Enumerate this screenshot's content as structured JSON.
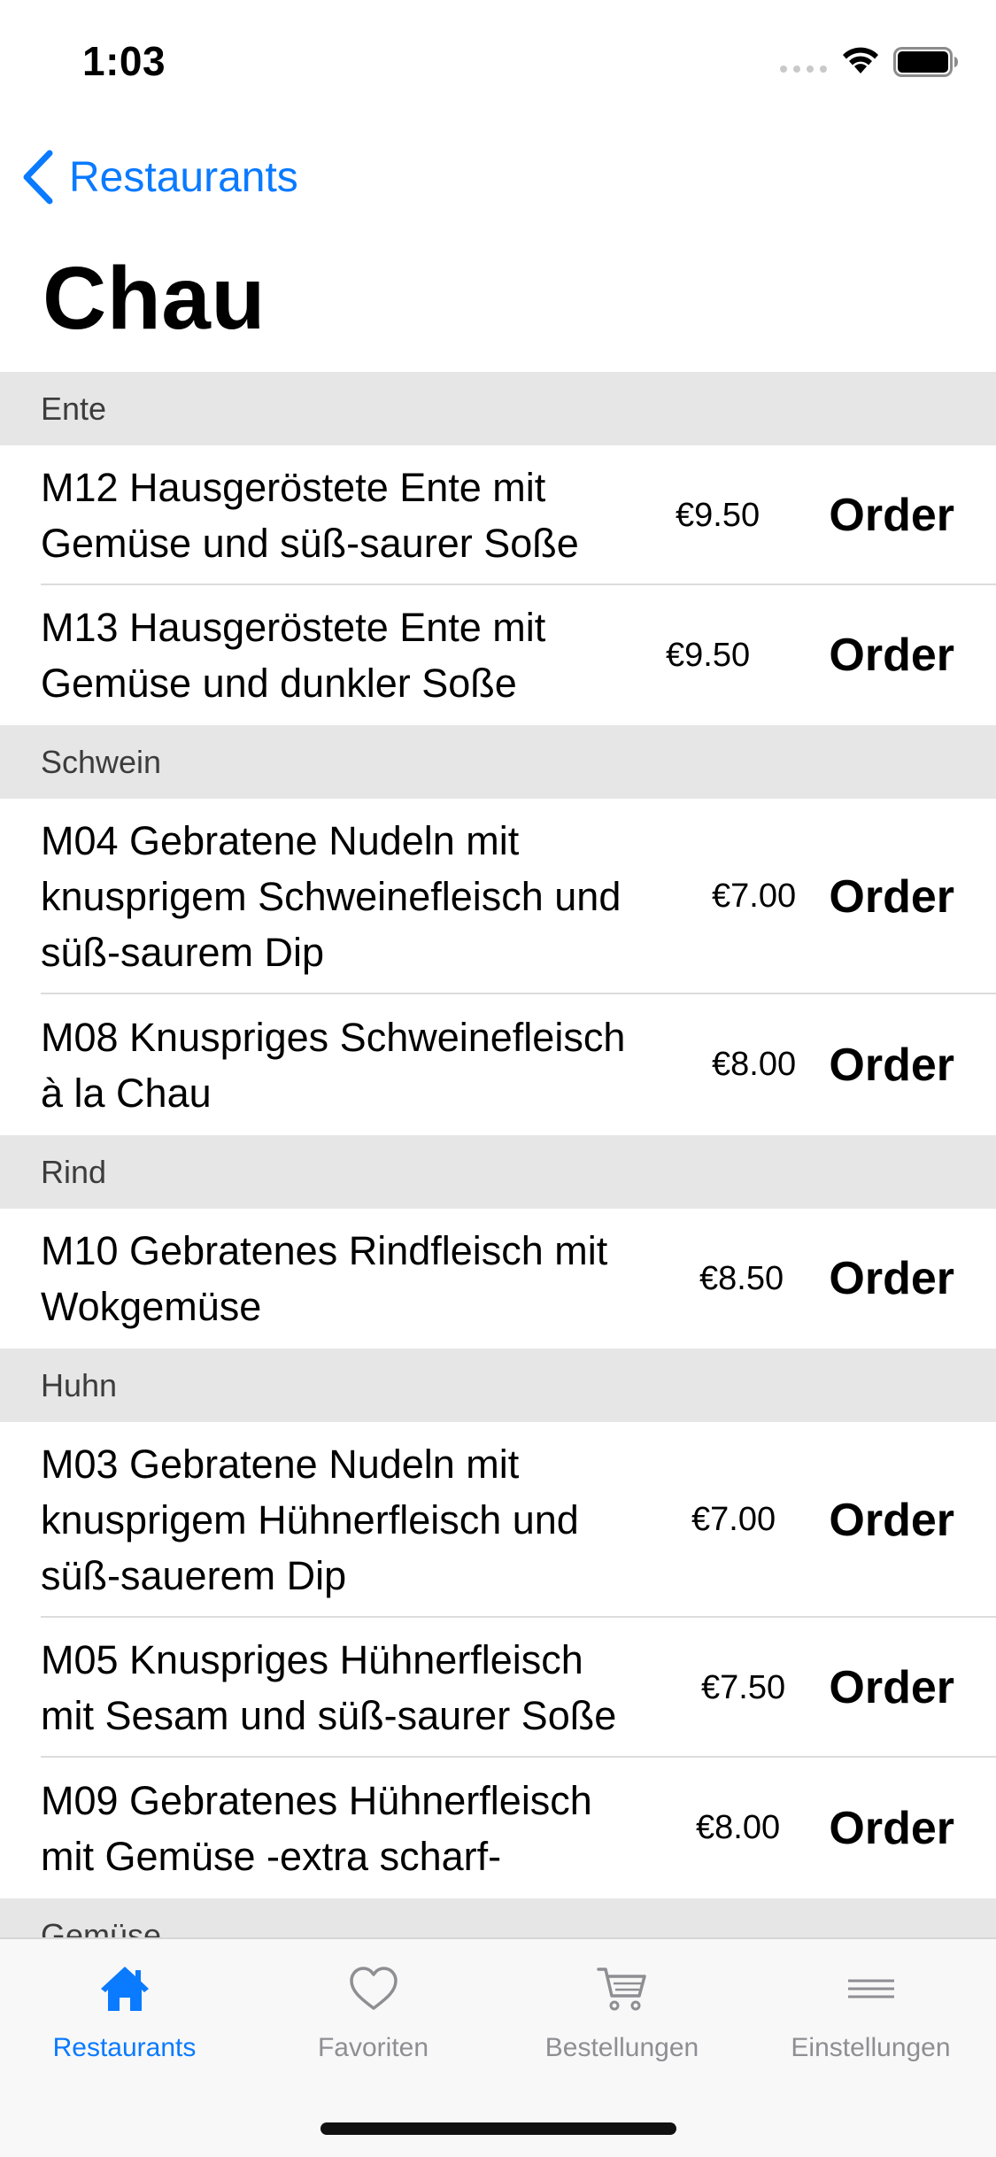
{
  "status": {
    "time": "1:03"
  },
  "nav": {
    "back_label": "Restaurants",
    "title": "Chau"
  },
  "sections": [
    {
      "title": "Ente",
      "items": [
        {
          "name": "M12 Hausgeröstete Ente mit\nGemüse und süß-saurer Soße",
          "price": "€9.50",
          "order_label": "Order"
        },
        {
          "name": "M13 Hausgeröstete Ente mit\nGemüse und dunkler Soße",
          "price": "€9.50",
          "order_label": "Order"
        }
      ]
    },
    {
      "title": "Schwein",
      "items": [
        {
          "name": "M04 Gebratene Nudeln mit\nknusprigem Schweinefleisch und\nsüß-saurem Dip",
          "price": "€7.00",
          "order_label": "Order"
        },
        {
          "name": "M08 Knuspriges Schweinefleisch\nà la Chau",
          "price": "€8.00",
          "order_label": "Order"
        }
      ]
    },
    {
      "title": "Rind",
      "items": [
        {
          "name": "M10 Gebratenes Rindfleisch mit\nWokgemüse",
          "price": "€8.50",
          "order_label": "Order"
        }
      ]
    },
    {
      "title": "Huhn",
      "items": [
        {
          "name": "M03 Gebratene Nudeln mit\nknusprigem Hühnerfleisch und\nsüß-sauerem Dip",
          "price": "€7.00",
          "order_label": "Order"
        },
        {
          "name": "M05 Knuspriges Hühnerfleisch\nmit Sesam und süß-saurer Soße",
          "price": "€7.50",
          "order_label": "Order"
        },
        {
          "name": "M09 Gebratenes Hühnerfleisch\nmit Gemüse -extra scharf-",
          "price": "€8.00",
          "order_label": "Order"
        }
      ]
    },
    {
      "title": "Gemüse",
      "items": []
    }
  ],
  "tabs": [
    {
      "label": "Restaurants",
      "icon": "house-icon",
      "active": true
    },
    {
      "label": "Favoriten",
      "icon": "heart-icon",
      "active": false
    },
    {
      "label": "Bestellungen",
      "icon": "cart-icon",
      "active": false
    },
    {
      "label": "Einstellungen",
      "icon": "menu-lines-icon",
      "active": false
    }
  ],
  "colors": {
    "accent": "#0a7aff",
    "section_bg": "#e6e6e6",
    "inactive_tab": "#8e8e93"
  }
}
